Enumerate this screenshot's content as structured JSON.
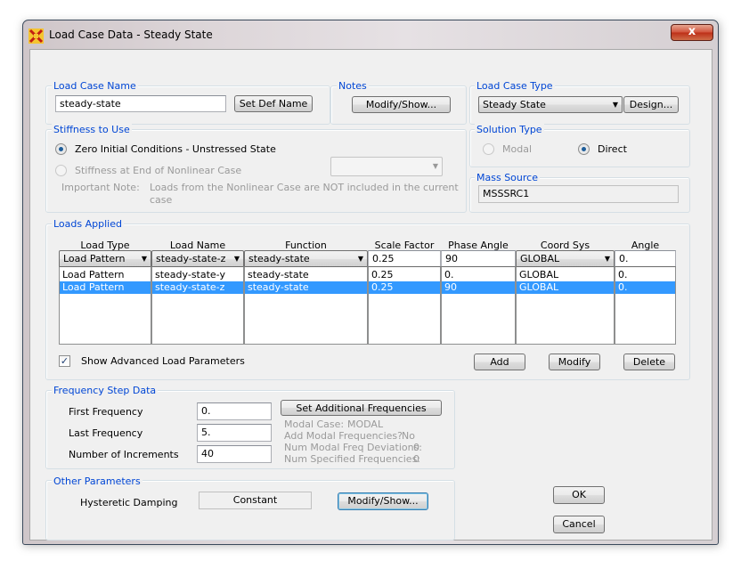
{
  "window": {
    "title": "Load Case Data - Steady State",
    "close_label": "x"
  },
  "load_case_name": {
    "group_label": "Load Case Name",
    "value": "steady-state",
    "set_def_name_label": "Set Def Name"
  },
  "notes": {
    "group_label": "Notes",
    "modify_show_label": "Modify/Show..."
  },
  "load_case_type": {
    "group_label": "Load Case Type",
    "selected": "Steady State",
    "design_label": "Design..."
  },
  "stiffness": {
    "group_label": "Stiffness to Use",
    "option_zero": "Zero Initial Conditions - Unstressed State",
    "option_nonlinear": "Stiffness at End of Nonlinear Case",
    "nonlinear_case_value": "",
    "important_note_label": "Important Note:",
    "important_note_line1": "Loads from the Nonlinear Case are NOT included in the current",
    "important_note_line2": "case"
  },
  "solution_type": {
    "group_label": "Solution Type",
    "modal_label": "Modal",
    "direct_label": "Direct",
    "selected": "Direct"
  },
  "mass_source": {
    "group_label": "Mass Source",
    "value": "MSSSRC1"
  },
  "loads_applied": {
    "group_label": "Loads Applied",
    "headers": [
      "Load Type",
      "Load Name",
      "Function",
      "Scale Factor",
      "Phase Angle",
      "Coord Sys",
      "Angle"
    ],
    "edit_row": [
      "Load Pattern",
      "steady-state-z",
      "steady-state",
      "0.25",
      "90",
      "GLOBAL",
      "0."
    ],
    "rows": [
      [
        "Load Pattern",
        "steady-state-y",
        "steady-state",
        "0.25",
        "0.",
        "GLOBAL",
        "0."
      ],
      [
        "Load Pattern",
        "steady-state-z",
        "steady-state",
        "0.25",
        "90",
        "GLOBAL",
        "0."
      ]
    ],
    "selected_row": 1,
    "show_advanced_label": "Show Advanced Load Parameters",
    "show_advanced_checked": true,
    "add_label": "Add",
    "modify_label": "Modify",
    "delete_label": "Delete"
  },
  "frequency_step": {
    "group_label": "Frequency Step Data",
    "first_label": "First Frequency",
    "first_value": "0.",
    "last_label": "Last Frequency",
    "last_value": "5.",
    "increments_label": "Number of Increments",
    "increments_value": "40",
    "set_additional_label": "Set Additional Frequencies",
    "modal_case_label": "Modal Case:",
    "modal_case_value": "MODAL",
    "add_modal_label": "Add Modal Frequencies?",
    "add_modal_value": "No",
    "num_dev_label": "Num Modal Freq Deviations:",
    "num_dev_value": "0",
    "num_spec_label": "Num Specified Frequencies:",
    "num_spec_value": "0"
  },
  "other_parameters": {
    "group_label": "Other Parameters",
    "hysteretic_label": "Hysteretic Damping",
    "hysteretic_value": "Constant",
    "modify_show_label": "Modify/Show..."
  },
  "dialog_buttons": {
    "ok_label": "OK",
    "cancel_label": "Cancel"
  },
  "colors": {
    "accent_blue": "#0046d5",
    "selection": "#3399ff",
    "close_red": "#c8432a"
  }
}
